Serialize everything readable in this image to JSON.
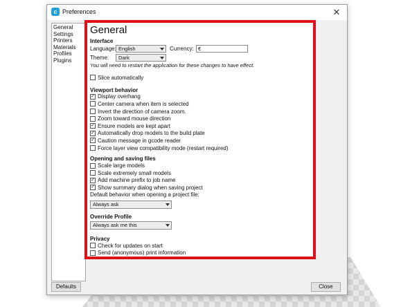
{
  "window": {
    "title": "Preferences",
    "app_icon": "cura-icon",
    "close_glyph": "✕"
  },
  "nav": {
    "items": [
      "General",
      "Settings",
      "Printers",
      "Materials",
      "Profiles",
      "Plugins"
    ]
  },
  "page": {
    "heading": "General"
  },
  "interface": {
    "title": "Interface",
    "language_label": "Language:",
    "language_value": "English",
    "currency_label": "Currency:",
    "currency_value": "€",
    "theme_label": "Theme:",
    "theme_value": "Dark",
    "restart_note": "You will need to restart the application for these changes to have effect."
  },
  "slice_auto": {
    "label": "Slice automatically",
    "checked": false
  },
  "viewport": {
    "title": "Viewport behavior",
    "items": [
      {
        "label": "Display overhang",
        "checked": true
      },
      {
        "label": "Center camera when item is selected",
        "checked": false
      },
      {
        "label": "Invert the direction of camera zoom.",
        "checked": false
      },
      {
        "label": "Zoom toward mouse direction",
        "checked": false
      },
      {
        "label": "Ensure models are kept apart",
        "checked": true
      },
      {
        "label": "Automatically drop models to the build plate",
        "checked": true
      },
      {
        "label": "Caution message in gcode reader",
        "checked": true
      },
      {
        "label": "Force layer view compatibility mode (restart required)",
        "checked": false
      }
    ]
  },
  "files": {
    "title": "Opening and saving files",
    "items": [
      {
        "label": "Scale large models",
        "checked": false
      },
      {
        "label": "Scale extremely small models",
        "checked": false
      },
      {
        "label": "Add machine prefix to job name",
        "checked": true
      },
      {
        "label": "Show summary dialog when saving project",
        "checked": true
      }
    ],
    "default_behavior_label": "Default behavior when opening a project file:",
    "default_behavior_value": "Always ask"
  },
  "override": {
    "title": "Override Profile",
    "value": "Always ask me this"
  },
  "privacy": {
    "title": "Privacy",
    "items": [
      {
        "label": "Check for updates on start",
        "checked": false
      },
      {
        "label": "Send (anonymous) print information",
        "checked": false
      }
    ]
  },
  "buttons": {
    "defaults": "Defaults",
    "close": "Close"
  },
  "colors": {
    "highlight_frame": "#e0101a",
    "app_icon": "#1e9fd7"
  }
}
